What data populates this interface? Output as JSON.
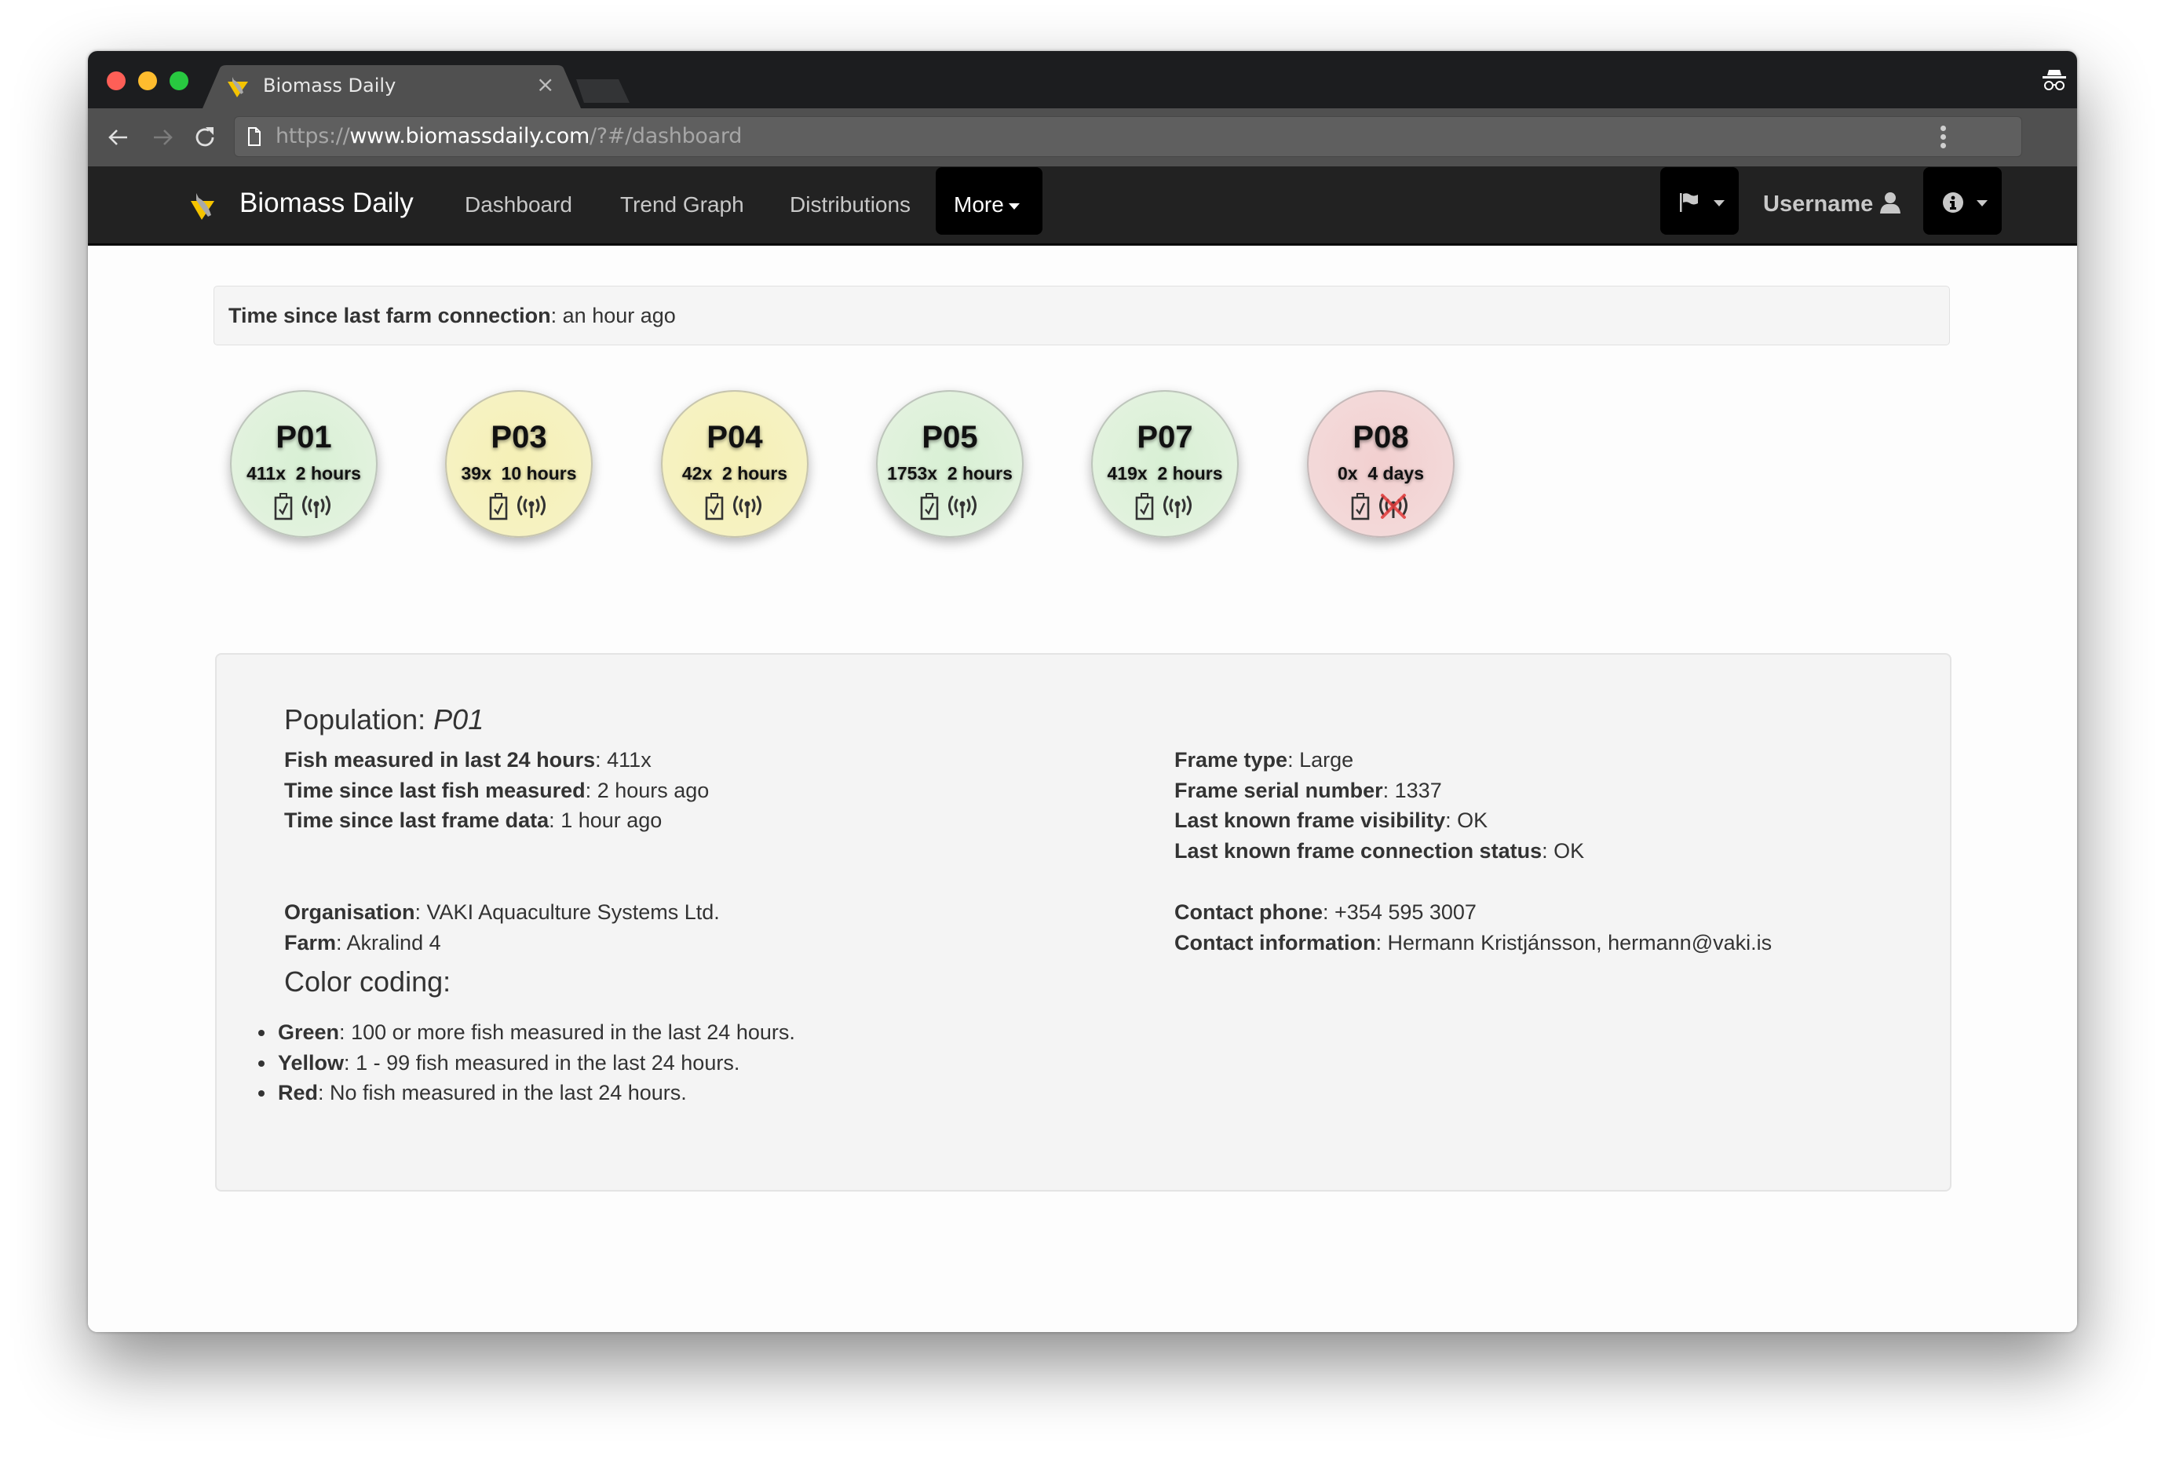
{
  "browser": {
    "tab_title": "Biomass Daily",
    "tab_close": "×",
    "url_scheme": "https://",
    "url_host": "www.biomassdaily.com",
    "url_path": "/?#/dashboard"
  },
  "navbar": {
    "brand": "Biomass Daily",
    "links": [
      "Dashboard",
      "Trend Graph",
      "Distributions"
    ],
    "more_label": "More",
    "username": "Username"
  },
  "connection": {
    "label": "Time since last farm connection",
    "value": "an hour ago"
  },
  "pens": [
    {
      "name": "P01",
      "count": "411x",
      "time": "2 hours",
      "status": "green",
      "signal_ok": true
    },
    {
      "name": "P03",
      "count": "39x",
      "time": "10 hours",
      "status": "yellow",
      "signal_ok": true
    },
    {
      "name": "P04",
      "count": "42x",
      "time": "2 hours",
      "status": "yellow",
      "signal_ok": true
    },
    {
      "name": "P05",
      "count": "1753x",
      "time": "2 hours",
      "status": "green",
      "signal_ok": true
    },
    {
      "name": "P07",
      "count": "419x",
      "time": "2 hours",
      "status": "green",
      "signal_ok": true
    },
    {
      "name": "P08",
      "count": "0x",
      "time": "4 days",
      "status": "red",
      "signal_ok": false
    }
  ],
  "details": {
    "title_label": "Population:",
    "population": "P01",
    "left": [
      {
        "label": "Fish measured in last 24 hours",
        "value": "411x"
      },
      {
        "label": "Time since last fish measured",
        "value": "2 hours ago"
      },
      {
        "label": "Time since last frame data",
        "value": "1 hour ago"
      }
    ],
    "left2": [
      {
        "label": "Organisation",
        "value": "VAKI Aquaculture Systems Ltd."
      },
      {
        "label": "Farm",
        "value": "Akralind 4"
      }
    ],
    "right": [
      {
        "label": "Frame type",
        "value": "Large"
      },
      {
        "label": "Frame serial number",
        "value": "1337"
      },
      {
        "label": "Last known frame visibility",
        "value": "OK"
      },
      {
        "label": "Last known frame connection status",
        "value": "OK"
      }
    ],
    "right2": [
      {
        "label": "Contact phone",
        "value": "+354 595 3007"
      },
      {
        "label": "Contact information",
        "value": "Hermann Kristjánsson, hermann@vaki.is"
      }
    ],
    "color_coding_title": "Color coding:",
    "color_coding": [
      {
        "label": "Green",
        "text": "100 or more fish measured in the last 24 hours."
      },
      {
        "label": "Yellow",
        "text": "1 - 99 fish measured in the last 24 hours."
      },
      {
        "label": "Red",
        "text": "No fish measured in the last 24 hours."
      }
    ]
  },
  "colors": {
    "green": "#e0f2dc",
    "yellow": "#f6f1bf",
    "red": "#f3d6d6",
    "navbar": "#222222",
    "signal_lost": "#e23b3b"
  }
}
